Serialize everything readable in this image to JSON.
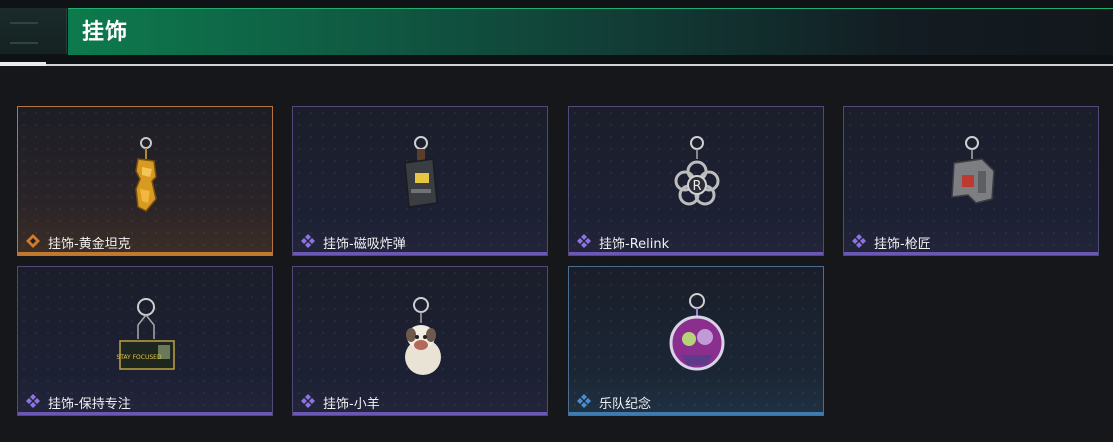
{
  "header": {
    "title": "挂饰"
  },
  "items": [
    {
      "label": "挂饰-黄金坦克",
      "rarity": "gold",
      "icon": "gold-tank-charm-icon"
    },
    {
      "label": "挂饰-磁吸炸弹",
      "rarity": "purple",
      "icon": "magnetic-bomb-charm-icon"
    },
    {
      "label": "挂饰-Relink",
      "rarity": "purple",
      "icon": "relink-charm-icon"
    },
    {
      "label": "挂饰-枪匠",
      "rarity": "purple",
      "icon": "gunsmith-charm-icon"
    },
    {
      "label": "挂饰-保持专注",
      "rarity": "purple",
      "icon": "stay-focused-charm-icon"
    },
    {
      "label": "挂饰-小羊",
      "rarity": "purple",
      "icon": "lamb-charm-icon"
    },
    {
      "label": "乐队纪念",
      "rarity": "blue",
      "icon": "band-memento-charm-icon"
    }
  ],
  "art_text": {
    "stay_focused_sign": "STAY FOCUSED",
    "relink_letter": "R"
  },
  "colors": {
    "gold": "#c0792f",
    "purple": "#7b62d6",
    "blue": "#3f86c4",
    "accent_green": "#0d7a4d"
  }
}
